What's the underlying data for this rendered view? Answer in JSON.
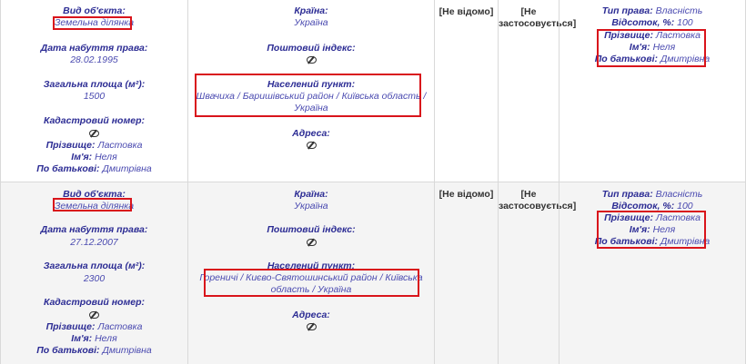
{
  "columns_text": {
    "not_known": "[Не відомо]",
    "not_applicable_1": "[Не",
    "not_applicable_2": "застосовується]"
  },
  "labels": {
    "object_type": "Вид об'єкта:",
    "acquired_date": "Дата набуття права:",
    "total_area": "Загальна площа (м²):",
    "cadastral": "Кадастровий номер:",
    "surname": "Прізвище:",
    "name": "Ім'я:",
    "patronymic": "По батькові:",
    "country": "Країна:",
    "postal_index": "Поштовий індекс:",
    "settlement": "Населений пункт:",
    "address": "Адреса:",
    "right_type": "Тип права:",
    "percent": "Відсоток, %:"
  },
  "records": [
    {
      "object_type": "Земельна ділянка",
      "acquired_date": "28.02.1995",
      "total_area": "1500",
      "surname": "Ластовка",
      "name": "Неля",
      "patronymic": "Дмитрівна",
      "country": "Україна",
      "settlement_line1": "Швачиха / Баришівський район / Київська область /",
      "settlement_line2": "Україна",
      "right_type": "Власність",
      "percent": "100",
      "owner_surname": "Ластовка",
      "owner_name": "Неля",
      "owner_patronymic": "Дмитрівна"
    },
    {
      "object_type": "Земельна ділянка",
      "acquired_date": "27.12.2007",
      "total_area": "2300",
      "surname": "Ластовка",
      "name": "Неля",
      "patronymic": "Дмитрівна",
      "country": "Україна",
      "settlement_line1": "Гореничі / Києво-Святошинський район / Київська",
      "settlement_line2": "область / Україна",
      "right_type": "Власність",
      "percent": "100",
      "owner_surname": "Ластовка",
      "owner_name": "Неля",
      "owner_patronymic": "Дмитрівна"
    }
  ],
  "icons": {
    "hidden_value": "eye-slash-icon"
  },
  "colors": {
    "highlight_border": "#d9141b",
    "label_text": "#2c2c94",
    "value_text": "#4a4ab0"
  }
}
